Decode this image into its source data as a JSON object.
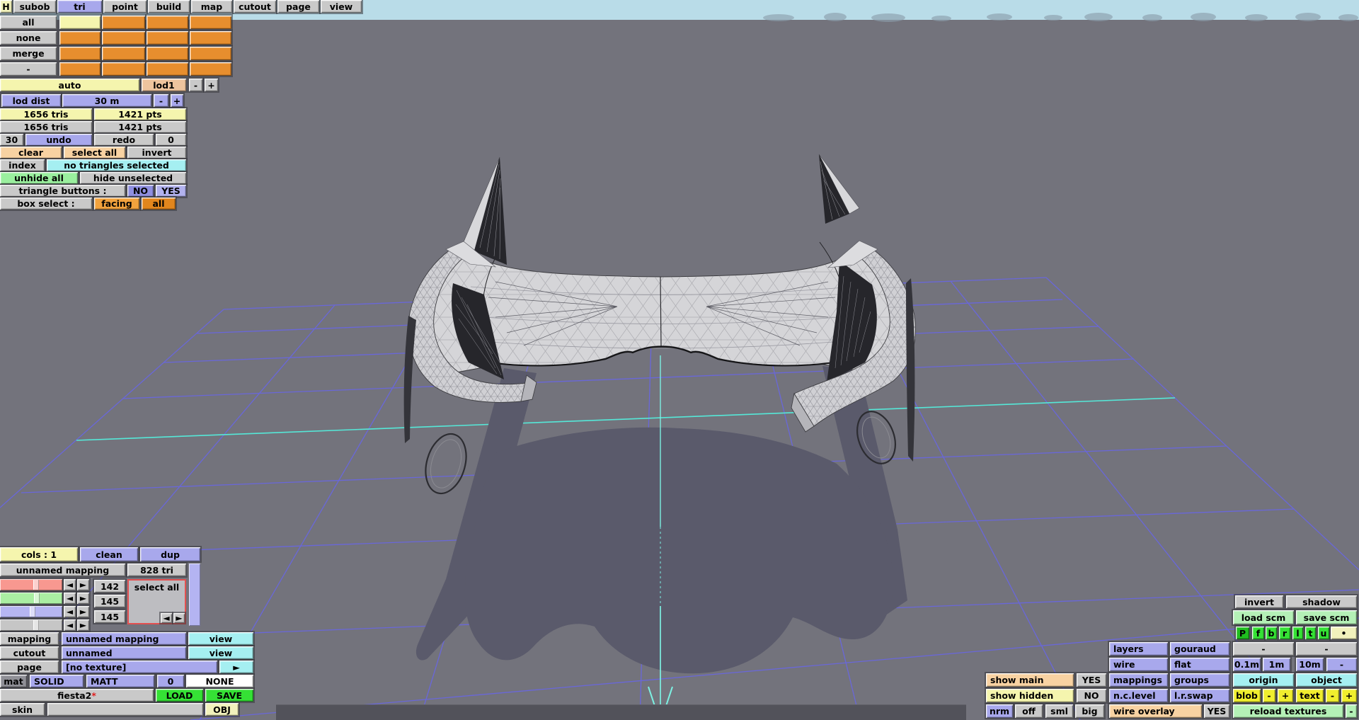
{
  "colors": {
    "viewport_bg": "#73737c",
    "sky": "#b9dce8",
    "grid_purple": "#6966e4",
    "grid_cyan": "#55e8d8",
    "axis_cyan": "#7df0e2",
    "shadow": "#5a5a6b",
    "car_body": "#d5d5d8",
    "accent_orange": "#e78e2e"
  },
  "menubar": {
    "items": [
      "H",
      "subob",
      "tri",
      "point",
      "build",
      "map",
      "cutout",
      "page",
      "view"
    ]
  },
  "subob": {
    "rows": [
      "all",
      "none",
      "merge",
      "-"
    ],
    "auto": "auto",
    "lod": "lod1",
    "minus": "-",
    "plus": "+"
  },
  "lod": {
    "label": "lod dist",
    "value": "30 m",
    "minus": "-",
    "plus": "+"
  },
  "stats": {
    "tris_sel": "1656 tris",
    "pts_sel": "1421 pts",
    "tris_total": "1656 tris",
    "pts_total": "1421 pts"
  },
  "history": {
    "undo_count": "30",
    "undo": "undo",
    "redo": "redo",
    "redo_count": "0"
  },
  "sel": {
    "clear": "clear",
    "select_all": "select all",
    "invert": "invert",
    "index": "index",
    "status": "no triangles selected",
    "unhide_all": "unhide all",
    "hide_unselected": "hide unselected",
    "triangle_buttons_label": "triangle buttons :",
    "no": "NO",
    "yes": "YES",
    "box_select_label": "box select :",
    "facing": "facing",
    "all": "all"
  },
  "cols_panel": {
    "cols": "cols : 1",
    "clean": "clean",
    "dup": "dup",
    "mapping_name": "unnamed mapping",
    "tri_count": "828 tri",
    "select_all": "select all",
    "sliders": [
      {
        "name": "red-channel",
        "value": "142"
      },
      {
        "name": "green-channel",
        "value": "145"
      },
      {
        "name": "blue-channel",
        "value": "145"
      },
      {
        "name": "gray-channel",
        "value": ""
      }
    ]
  },
  "obj_panel": {
    "mapping_label": "mapping",
    "mapping_value": "unnamed mapping",
    "mapping_view": "view",
    "cutout_label": "cutout",
    "cutout_value": "unnamed",
    "cutout_view": "view",
    "page_label": "page",
    "page_value": "[no texture]",
    "page_arrow": "►",
    "mat": "mat",
    "solid": "SOLID",
    "matt": "MATT",
    "zero": "0",
    "none": "NONE",
    "file_name": "fiesta2",
    "dirty": "*",
    "load": "LOAD",
    "save": "SAVE",
    "skin": "skin",
    "obj": "OBJ"
  },
  "view_panel": {
    "invert": "invert",
    "shadow": "shadow",
    "load_scm": "load scm",
    "save_scm": "save scm",
    "proj": [
      "P",
      "f",
      "b",
      "r",
      "l",
      "t",
      "u"
    ],
    "dot": "•",
    "layers": "layers",
    "gouraud": "gouraud",
    "dash": "-",
    "wire": "wire",
    "flat": "flat",
    "m01": "0.1m",
    "m1": "1m",
    "m10": "10m",
    "show_main": "show main",
    "show_main_val": "YES",
    "mappings": "mappings",
    "groups": "groups",
    "origin": "origin",
    "object": "object",
    "show_hidden": "show hidden",
    "show_hidden_val": "NO",
    "nclevel": "n.c.level",
    "lrswap": "l.r.swap",
    "blob": "blob",
    "text": "text",
    "minus": "-",
    "plus": "+",
    "nrm": "nrm",
    "off": "off",
    "sml": "sml",
    "big": "big",
    "wire_overlay": "wire overlay",
    "wire_overlay_val": "YES",
    "reload": "reload textures"
  },
  "sym": {
    "left": "◄",
    "right": "►"
  }
}
